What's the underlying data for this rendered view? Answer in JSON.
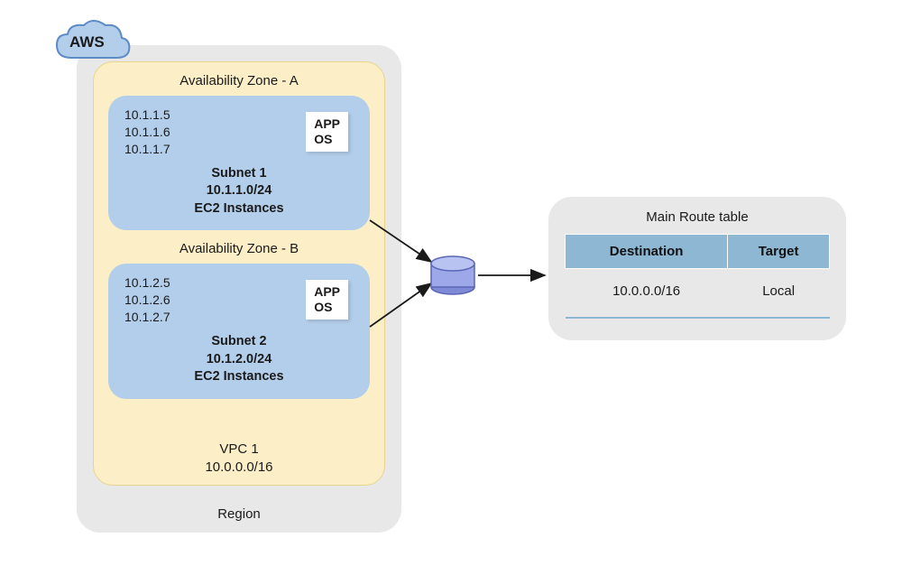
{
  "cloud": {
    "label": "AWS"
  },
  "region": {
    "label": "Region"
  },
  "vpc": {
    "name": "VPC 1",
    "cidr": "10.0.0.0/16"
  },
  "az_a": {
    "title": "Availability Zone - A"
  },
  "az_b": {
    "title": "Availability Zone - B"
  },
  "subnet1": {
    "ips": [
      "10.1.1.5",
      "10.1.1.6",
      "10.1.1.7"
    ],
    "name": "Subnet 1",
    "cidr": "10.1.1.0/24",
    "desc": "EC2 Instances",
    "app": {
      "line1": "APP",
      "line2": "OS"
    }
  },
  "subnet2": {
    "ips": [
      "10.1.2.5",
      "10.1.2.6",
      "10.1.2.7"
    ],
    "name": "Subnet 2",
    "cidr": "10.1.2.0/24",
    "desc": "EC2 Instances",
    "app": {
      "line1": "APP",
      "line2": "OS"
    }
  },
  "route_table": {
    "title": "Main Route table",
    "headers": {
      "destination": "Destination",
      "target": "Target"
    },
    "rows": [
      {
        "destination": "10.0.0.0/16",
        "target": "Local"
      }
    ]
  }
}
